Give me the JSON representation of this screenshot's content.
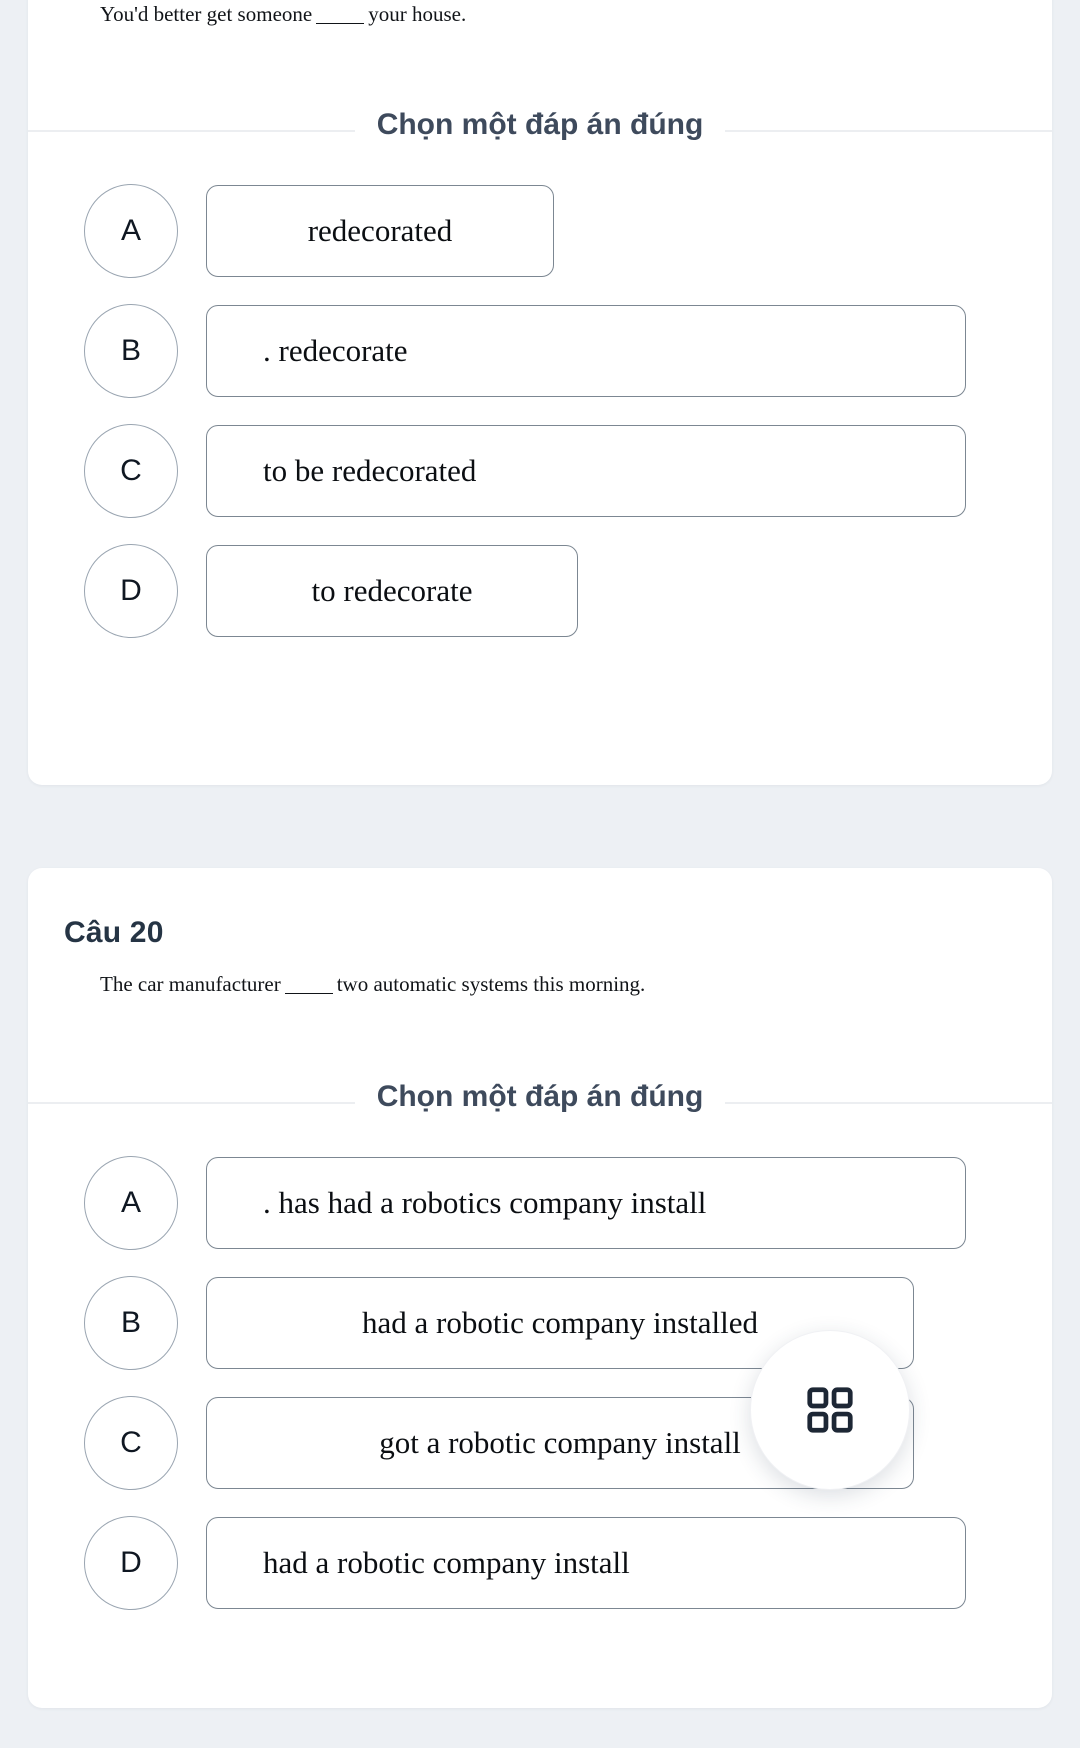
{
  "theme": {
    "page_background": "#edf0f4",
    "card_background": "#ffffff",
    "heading_color": "#253444",
    "divider_color": "#eceef1",
    "option_border_color": "#7c8792",
    "letter_border_color": "#9aa5b1",
    "fab_icon_color": "#1d2735"
  },
  "questions": [
    {
      "number_label": "",
      "stem_before": "You'd better get someone",
      "stem_after": "your house.",
      "choose_label": "Chọn một đáp án đúng",
      "options": [
        {
          "letter": "A",
          "text": "redecorated"
        },
        {
          "letter": "B",
          "text": ". redecorate"
        },
        {
          "letter": "C",
          "text": "to be redecorated"
        },
        {
          "letter": "D",
          "text": "to redecorate"
        }
      ]
    },
    {
      "number_label": "Câu 20",
      "stem_before": "The car manufacturer",
      "stem_after": "two automatic systems this morning.",
      "choose_label": "Chọn một đáp án đúng",
      "options": [
        {
          "letter": "A",
          "text": ". has had a robotics company install"
        },
        {
          "letter": "B",
          "text": "had a robotic company installed"
        },
        {
          "letter": "C",
          "text": "got a robotic company install"
        },
        {
          "letter": "D",
          "text": "had a robotic company install"
        }
      ]
    }
  ],
  "fab": {
    "icon": "grid-2x2-icon",
    "label": ""
  }
}
